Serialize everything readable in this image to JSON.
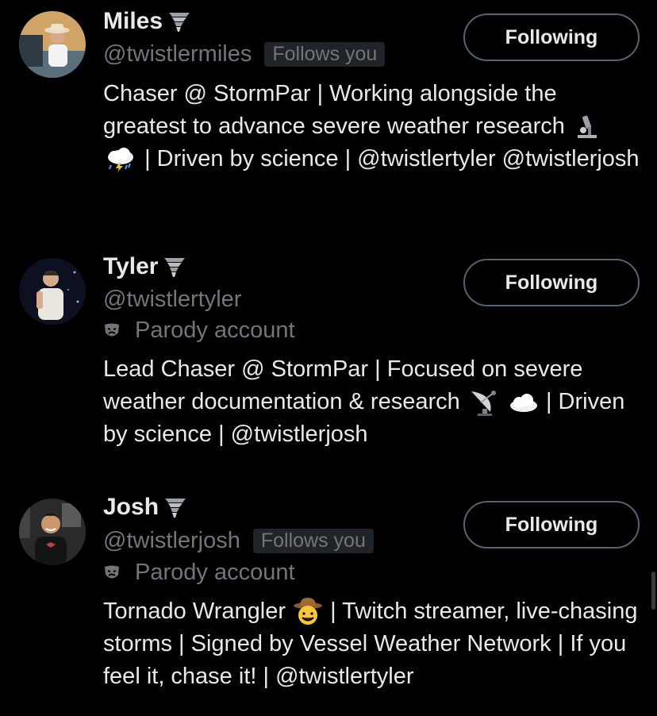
{
  "users": [
    {
      "name": "Miles",
      "handle": "@twistlermiles",
      "follows_you": "Follows you",
      "parody": "",
      "bio_parts": [
        "Chaser @ StormPar | Working alongside the greatest to advance severe weather research",
        " | Driven by science | @twistlertyler @twistlerjosh"
      ],
      "button": "Following"
    },
    {
      "name": "Tyler",
      "handle": "@twistlertyler",
      "follows_you": "",
      "parody": "Parody account",
      "bio_parts": [
        "Lead Chaser @ StormPar | Focused on severe weather documentation & research",
        " | Driven by science | @twistlerjosh"
      ],
      "button": "Following"
    },
    {
      "name": "Josh",
      "handle": "@twistlerjosh",
      "follows_you": "Follows you",
      "parody": "Parody account",
      "bio_parts": [
        "Tornado Wrangler",
        " | Twitch streamer, live-chasing storms | Signed by Vessel Weather Network | If you feel it, chase it! | @twistlertyler"
      ],
      "button": "Following"
    }
  ],
  "icons": {
    "name_badge": "tornado-icon",
    "parody": "theater-mask-icon",
    "bio_emojis_user1": [
      "microscope-icon",
      "storm-cloud-icon"
    ],
    "bio_emojis_user2": [
      "satellite-dish-icon",
      "cloud-icon"
    ],
    "bio_emojis_user3": [
      "cowboy-face-icon"
    ]
  }
}
